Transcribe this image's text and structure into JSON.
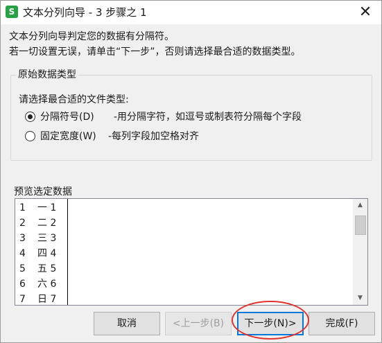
{
  "window": {
    "title": "文本分列向导 - 3 步骤之 1",
    "app_icon_glyph": "S",
    "close_glyph": "✕"
  },
  "intro": {
    "line1": "文本分列向导判定您的数据有分隔符。",
    "line2": "若一切设置无误，请单击“下一步”，否则请选择最合适的数据类型。"
  },
  "original_type": {
    "legend": "原始数据类型",
    "prompt": "请选择最合适的文件类型:",
    "options": [
      {
        "label": "分隔符号(D)",
        "description": "-用分隔字符，如逗号或制表符分隔每个字段",
        "selected": true
      },
      {
        "label": "固定宽度(W)",
        "description": "-每列字段加空格对齐",
        "selected": false
      }
    ]
  },
  "preview": {
    "label": "预览选定数据",
    "rows": [
      {
        "num": "1",
        "text": "一 1"
      },
      {
        "num": "2",
        "text": "二 2"
      },
      {
        "num": "3",
        "text": "三 3"
      },
      {
        "num": "4",
        "text": "四 4"
      },
      {
        "num": "5",
        "text": "五 5"
      },
      {
        "num": "6",
        "text": "六 6"
      },
      {
        "num": "7",
        "text": "日 7"
      }
    ]
  },
  "buttons": {
    "cancel": "取消",
    "back": "<上一步(B)",
    "next": "下一步(N)>",
    "finish": "完成(F)"
  },
  "colors": {
    "app_icon": "#26a146",
    "focus_border": "#0078d7",
    "annotation": "#e5312b"
  }
}
